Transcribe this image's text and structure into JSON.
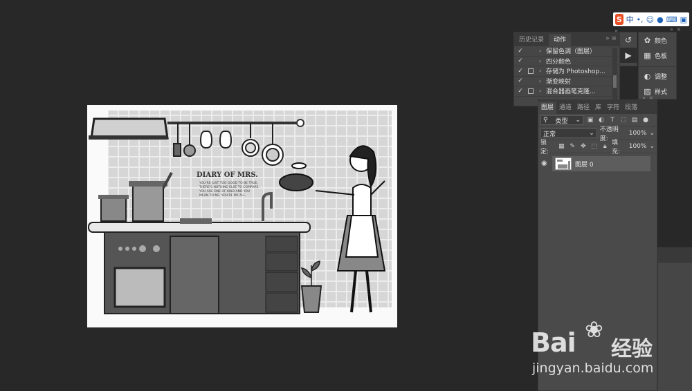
{
  "ime": {
    "logo": "S",
    "mode": "中",
    "punct": "•,",
    "icons": [
      "emoji-icon",
      "mic-icon",
      "keyboard-icon",
      "skin-icon"
    ]
  },
  "history_panel": {
    "tabs": [
      "历史记录",
      "动作"
    ],
    "active_tab": "动作",
    "collapse": "»",
    "menu": "≡",
    "actions": [
      {
        "checked": true,
        "box": false,
        "label": "保留色调（图层）"
      },
      {
        "checked": true,
        "box": false,
        "label": "四分颜色"
      },
      {
        "checked": true,
        "box": true,
        "label": "存储为 Photoshop..."
      },
      {
        "checked": true,
        "box": false,
        "label": "渐变映射"
      },
      {
        "checked": true,
        "box": true,
        "label": "混合器画笔克隆..."
      }
    ]
  },
  "color_panel": {
    "items": [
      {
        "icon": "palette-icon",
        "label": "颜色"
      },
      {
        "icon": "swatches-icon",
        "label": "色板"
      },
      {
        "icon": "adjustments-icon",
        "label": "调整"
      },
      {
        "icon": "styles-icon",
        "label": "样式"
      }
    ]
  },
  "layers_panel": {
    "tabs": [
      "图层",
      "通道",
      "路径",
      "库",
      "字符",
      "段落"
    ],
    "active_tab": "图层",
    "filter_label": "类型",
    "blend_mode": "正常",
    "opacity_label": "不透明度:",
    "opacity_value": "100%",
    "lock_label": "锁定:",
    "fill_label": "填充:",
    "fill_value": "100%",
    "layers": [
      {
        "name": "图层 0",
        "visible": true
      }
    ]
  },
  "canvas": {
    "title_text": "DIARY OF MRS.",
    "body_lines": [
      "YOU'RE JUST TOO GOOD TO BE TRUE.",
      "THERE'S NOTHING ELSE TO COMPARE.",
      "YOU ARE ONE OF KIND AND YOU",
      "MEAN TO ME. YOU'RE MY ALL."
    ]
  },
  "watermark": {
    "brand": "Bai",
    "brand2": "经验",
    "url": "jingyan.baidu.com"
  }
}
